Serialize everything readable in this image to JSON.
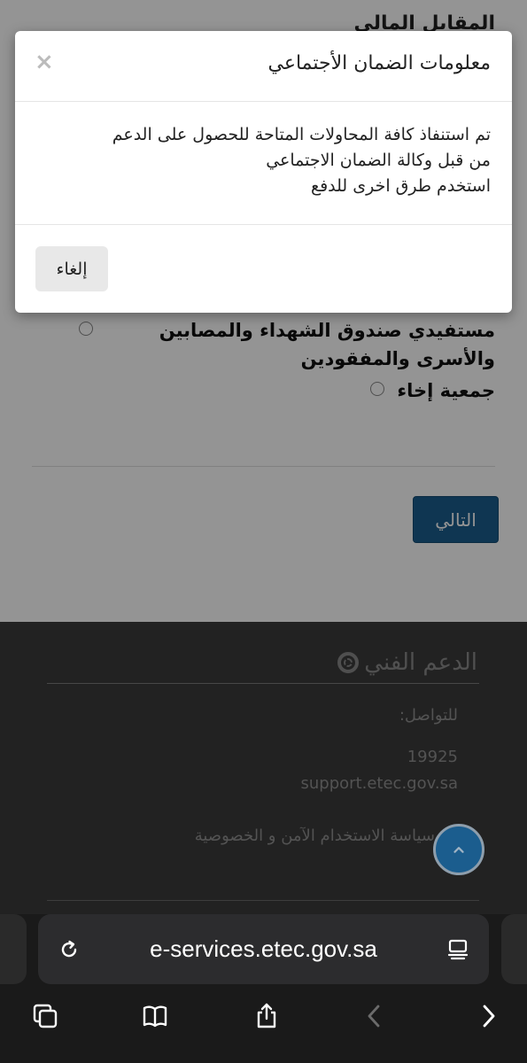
{
  "page": {
    "header_clip": "المقابل المالي",
    "options": [
      "مستفيدي صندوق الشهداء والمصابين والأسرى والمفقودين",
      "جمعية إخاء"
    ],
    "next_label": "التالي"
  },
  "footer": {
    "support_title": "الدعم الفني",
    "contact_label": "للتواصل:",
    "phone": "19925",
    "email": "support.etec.gov.sa",
    "privacy": "سياسة الاستخدام الآمن و الخصوصية"
  },
  "modal": {
    "title": "معلومات الضمان الأجتماعي",
    "close": "×",
    "body_line1": "تم استنفاذ كافة المحاولات المتاحة للحصول على الدعم",
    "body_line2": "من قبل وكالة الضمان الاجتماعي",
    "body_line3": "استخدم طرق اخرى للدفع",
    "cancel_label": "إلغاء"
  },
  "browser": {
    "url": "e-services.etec.gov.sa",
    "icons": [
      "reload-icon",
      "reader-icon",
      "tabs-icon",
      "bookmarks-icon",
      "share-icon",
      "back-icon",
      "forward-icon"
    ]
  },
  "colors": {
    "primary": "#1b5d8e",
    "footer_bg": "#3b3b3b",
    "chrome_bg": "#1a1a1a"
  }
}
